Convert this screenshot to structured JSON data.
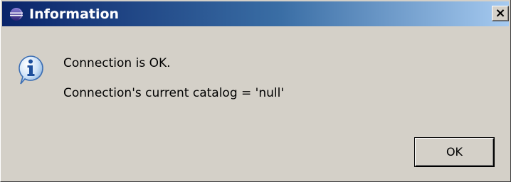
{
  "window": {
    "title": "Information",
    "title_icon": "eclipse-icon",
    "close_glyph": "×"
  },
  "dialog": {
    "icon": "info-icon",
    "messages": [
      "Connection is OK.",
      "Connection's current catalog = 'null'"
    ],
    "ok_label": "OK"
  },
  "colors": {
    "titlebar_start": "#0a246a",
    "titlebar_end": "#a6caf0",
    "dialog_background": "#d4d0c8"
  }
}
